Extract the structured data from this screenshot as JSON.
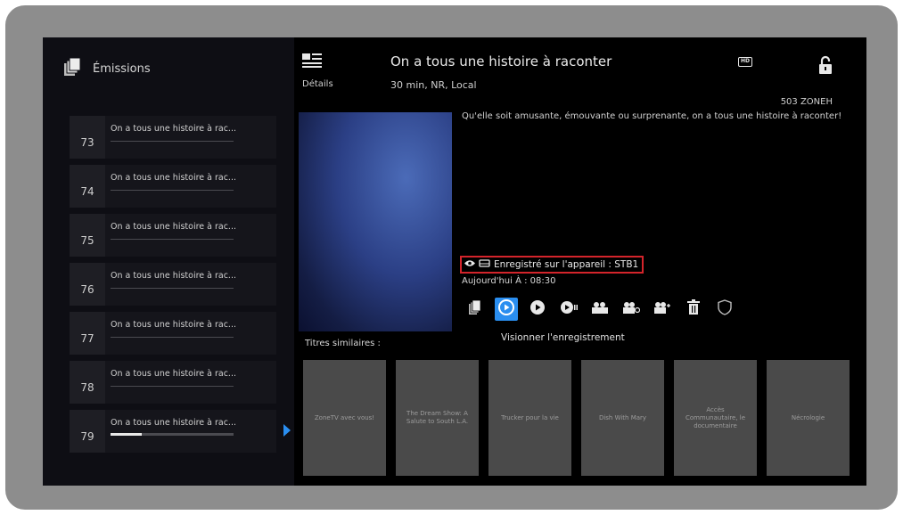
{
  "sidebar": {
    "title": "Émissions",
    "episodes": [
      {
        "num": "73",
        "title": "On a tous une histoire à rac..."
      },
      {
        "num": "74",
        "title": "On a tous une histoire à rac..."
      },
      {
        "num": "75",
        "title": "On a tous une histoire à rac..."
      },
      {
        "num": "76",
        "title": "On a tous une histoire à rac..."
      },
      {
        "num": "77",
        "title": "On a tous une histoire à rac..."
      },
      {
        "num": "78",
        "title": "On a tous une histoire à rac..."
      },
      {
        "num": "79",
        "title": "On a tous une histoire à rac...",
        "progress": 0.25
      }
    ]
  },
  "header": {
    "details_label": "Détails",
    "title": "On a tous une histoire à raconter",
    "meta": "30 min, NR, Local",
    "hd_badge": "HD",
    "channel": "503 ZONEH"
  },
  "program": {
    "description": "Qu'elle soit amusante, émouvante ou surprenante, on a tous une histoire à raconter!",
    "recorded_on": "Enregistré sur l'appareil : STB1",
    "schedule": "Aujourd'hui À : 08:30"
  },
  "actions": {
    "focused_label": "Visionner l'enregistrement",
    "icons": [
      "episodes-icon",
      "play-recording-icon",
      "play-icon",
      "resume-icon",
      "record-icon",
      "record-series-icon",
      "record-settings-icon",
      "delete-icon",
      "protect-icon"
    ]
  },
  "similar": {
    "label": "Titres similaires :",
    "items": [
      "ZoneTV avec vous!",
      "The Dream Show: A Salute to South L.A.",
      "Trucker pour la vie",
      "Dish With Mary",
      "Accès Communautaire, le documentaire",
      "Nécrologie"
    ]
  },
  "colors": {
    "accent": "#2a8ef0",
    "highlight_border": "#d4242b",
    "background": "#000000"
  }
}
